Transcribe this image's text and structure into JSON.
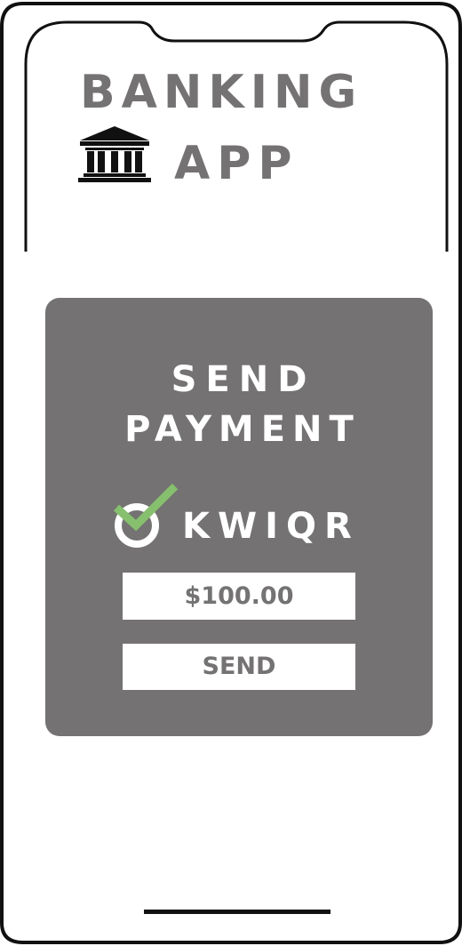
{
  "app_title": {
    "line1": "BANKING",
    "line2": "APP",
    "icon": "bank-building-icon"
  },
  "payment_card": {
    "heading_line1": "SEND",
    "heading_line2": "PAYMENT",
    "brand": {
      "name": "KWIQR",
      "icon": "checkmark-circle-icon"
    },
    "amount_value": "$100.00",
    "send_label": "SEND"
  },
  "colors": {
    "text_gray": "#747272",
    "card_background": "#747272",
    "card_text": "#ffffff",
    "check_green": "#86c06e",
    "phone_outline": "#111111",
    "page_background": "#ffffff"
  }
}
